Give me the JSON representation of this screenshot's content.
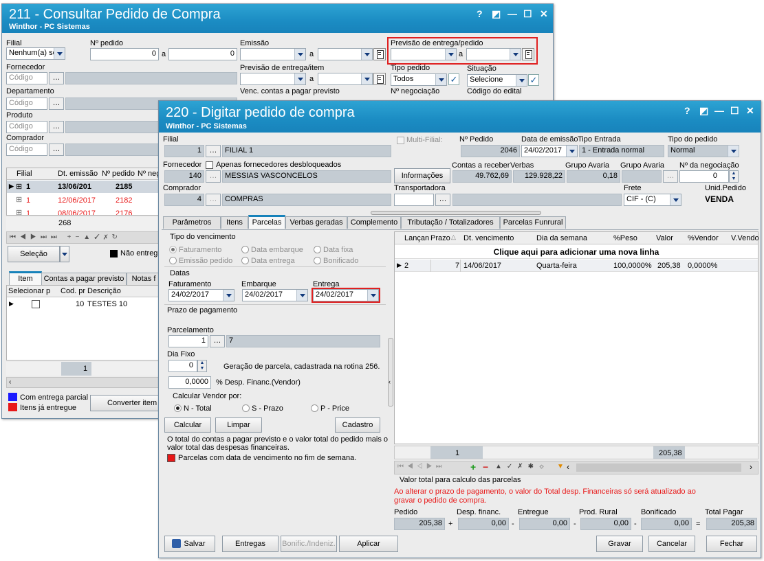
{
  "w211": {
    "title": "211 - Consultar Pedido de Compra",
    "subtitle": "Winthor - PC Sistemas",
    "controls": [
      "?",
      "◩",
      "—",
      "☐",
      "✕"
    ],
    "filial_label": "Filial",
    "filial_value": "Nenhum(a) se",
    "npedido_label": "Nº pedido",
    "npedido_from": "0",
    "npedido_to": "0",
    "a": "a",
    "emissao_label": "Emissão",
    "prev_pedido_label": "Previsão de entrega/pedido",
    "fornecedor_label": "Fornecedor",
    "codigo_ph": "Código",
    "prev_item_label": "Previsão de entrega/item",
    "tipo_pedido_label": "Tipo pedido",
    "tipo_pedido_value": "Todos",
    "situacao_label": "Situação",
    "situacao_value": "Selecione",
    "departamento_label": "Departamento",
    "venc_label": "Venc. contas a  pagar previsto",
    "nneg_label": "Nº negociação",
    "cod_edital_label": "Código do edital",
    "produto_label": "Produto",
    "comprador_label": "Comprador",
    "grid_headers": [
      "Filial",
      "Dt. emissão",
      "Nº pedido",
      "Nº neg"
    ],
    "rows": [
      {
        "filial": "1",
        "data": "13/06/201",
        "pedido": "2185"
      },
      {
        "filial": "1",
        "data": "12/06/2017",
        "pedido": "2182"
      },
      {
        "filial": "1",
        "data": "08/06/2017",
        "pedido": "2176"
      }
    ],
    "count": "268",
    "selecao_btn": "Seleção",
    "nao_entreg": "Não entreg",
    "tabs": [
      "Item",
      "Contas a pagar previsto",
      "Notas f"
    ],
    "item_headers": [
      "Selecionar p",
      "Cod. pr",
      "Descrição"
    ],
    "item_row": {
      "cod": "10",
      "desc": "TESTES 10"
    },
    "item_count": "1",
    "legend1": "Com entrega parcial",
    "legend2": "Itens já entregue",
    "converter_btn": "Converter item"
  },
  "w220": {
    "title": "220 - Digitar pedido de compra",
    "subtitle": "Winthor - PC Sistemas",
    "controls": [
      "?",
      "◩",
      "—",
      "☐",
      "✕"
    ],
    "filial_label": "Filial",
    "filial_code": "1",
    "filial_name": "FILIAL 1",
    "multifilial_label": "Multi-Filial:",
    "npedido_label": "Nº Pedido",
    "npedido_value": "2046",
    "data_emissao_label": "Data de emissão",
    "data_emissao_value": "24/02/2017",
    "tipo_entrada_label": "Tipo Entrada",
    "tipo_entrada_value": "1 - Entrada normal",
    "tipo_pedido_label": "Tipo do pedido",
    "tipo_pedido_value": "Normal",
    "fornecedor_label": "Fornecedor",
    "apenas_label": "Apenas fornecedores desbloqueados",
    "fornecedor_code": "140",
    "fornecedor_name": "MESSIAS VASCONCELOS",
    "informacoes_btn": "Informações",
    "contas_receber_label": "Contas a receber",
    "contas_receber_value": "49.762,69",
    "verbas_label": "Verbas",
    "verbas_value": "129.928,22",
    "grupo_avaria_label": "Grupo Avaria",
    "grupo_avaria_value": "0,18",
    "grupo_avaria2_label": "Grupo Avaria",
    "nneg_label": "Nº da negociação",
    "nneg_value": "0",
    "comprador_label": "Comprador",
    "comprador_code": "4",
    "comprador_name": "COMPRAS",
    "transportadora_label": "Transportadora",
    "frete_label": "Frete",
    "frete_value": "CIF - (C)",
    "unid_label": "Unid.Pedido",
    "unid_value": "VENDA",
    "tabs": [
      "Parâmetros",
      "Itens",
      "Parcelas",
      "Verbas geradas",
      "Complemento",
      "Tributação / Totalizadores",
      "Parcelas Funrural"
    ],
    "tipo_venc_label": "Tipo do vencimento",
    "radios_venc": [
      "Faturamento",
      "Data embarque",
      "Data fixa",
      "Emissão pedido",
      "Data entrega",
      "Bonificado"
    ],
    "datas_label": "Datas",
    "faturamento_label": "Faturamento",
    "faturamento_value": "24/02/2017",
    "embarque_label": "Embarque",
    "embarque_value": "24/02/2017",
    "entrega_label": "Entrega",
    "entrega_value": "24/02/2017",
    "prazo_label": "Prazo de pagamento",
    "parcelamento_label": "Parcelamento",
    "parcelamento_code": "1",
    "parcelamento_desc": "7",
    "dia_fixo_label": "Dia Fixo",
    "dia_fixo_value": "0",
    "geracao_text": "Geração de parcela, cadastrada na rotina 256.",
    "desp_value": "0,0000",
    "desp_label": "% Desp. Financ.(Vendor)",
    "calc_vendor_label": "Calcular Vendor por:",
    "vendor_opts": [
      "N - Total",
      "S - Prazo",
      "P - Price"
    ],
    "calcular_btn": "Calcular",
    "limpar_btn": "Limpar",
    "cadastro_btn": "Cadastro",
    "info_text1": "O total do contas a pagar previsto e o valor total do pedido mais o",
    "info_text2": "valor total das despesas financeiras.",
    "legend_red": "Parcelas com data de vencimento no fim de semana.",
    "grid_headers": [
      "Lançan",
      "Prazo",
      "Dt. vencimento",
      "Dia da semana",
      "%Peso",
      "Valor",
      "%Vendor",
      "V.Vendo"
    ],
    "new_row": "Clique aqui para adicionar uma nova linha",
    "grid_row": {
      "lanc": "2",
      "prazo": "7",
      "dt": "14/06/2017",
      "dia": "Quarta-feira",
      "peso": "100,0000%",
      "valor": "205,38",
      "vendor": "0,0000%"
    },
    "footer_count": "1",
    "footer_total": "205,38",
    "valor_total_label": "Valor total para calculo das parcelas",
    "warning1": "Ao alterar o prazo de pagamento, o valor do Total desp. Financeiras só será atualizado ao",
    "warning2": "gravar o pedido de compra.",
    "totals": [
      {
        "label": "Pedido",
        "value": "205,38"
      },
      {
        "label": "Desp. financ.",
        "value": "0,00"
      },
      {
        "label": "Entregue",
        "value": "0,00"
      },
      {
        "label": "Prod. Rural",
        "value": "0,00"
      },
      {
        "label": "Bonificado",
        "value": "0,00"
      },
      {
        "label": "Total Pagar",
        "value": "205,38"
      }
    ],
    "ops": [
      "+",
      "-",
      "-",
      "-",
      "="
    ],
    "salvar_btn": "Salvar",
    "entregas_btn": "Entregas",
    "bonific_btn": "Bonific./Indeniz.",
    "aplicar_btn": "Aplicar",
    "gravar_btn": "Gravar",
    "cancelar_btn": "Cancelar",
    "fechar_btn": "Fechar"
  },
  "colors": {
    "title_bar": "#1b8cc3",
    "accent_red": "#e02020",
    "legend_blue": "#1a1aff",
    "legend_red": "#e81818"
  }
}
